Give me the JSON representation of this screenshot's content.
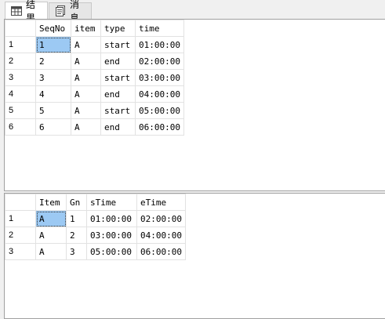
{
  "tabs": [
    {
      "label": "结果",
      "icon": "grid-icon"
    },
    {
      "label": "消息",
      "icon": "message-icon"
    }
  ],
  "result_top": {
    "columns": [
      "SeqNo",
      "item",
      "type",
      "time"
    ],
    "rows": [
      {
        "num": "1",
        "cells": [
          "1",
          "A",
          "start",
          "01:00:00"
        ]
      },
      {
        "num": "2",
        "cells": [
          "2",
          "A",
          "end",
          "02:00:00"
        ]
      },
      {
        "num": "3",
        "cells": [
          "3",
          "A",
          "start",
          "03:00:00"
        ]
      },
      {
        "num": "4",
        "cells": [
          "4",
          "A",
          "end",
          "04:00:00"
        ]
      },
      {
        "num": "5",
        "cells": [
          "5",
          "A",
          "start",
          "05:00:00"
        ]
      },
      {
        "num": "6",
        "cells": [
          "6",
          "A",
          "end",
          "06:00:00"
        ]
      }
    ],
    "selected": {
      "row": 0,
      "col": 0
    }
  },
  "result_bottom": {
    "columns": [
      "Item",
      "Gn",
      "sTime",
      "eTime"
    ],
    "rows": [
      {
        "num": "1",
        "cells": [
          "A",
          "1",
          "01:00:00",
          "02:00:00"
        ]
      },
      {
        "num": "2",
        "cells": [
          "A",
          "2",
          "03:00:00",
          "04:00:00"
        ]
      },
      {
        "num": "3",
        "cells": [
          "A",
          "3",
          "05:00:00",
          "06:00:00"
        ]
      }
    ],
    "selected": {
      "row": 0,
      "col": 0
    }
  }
}
